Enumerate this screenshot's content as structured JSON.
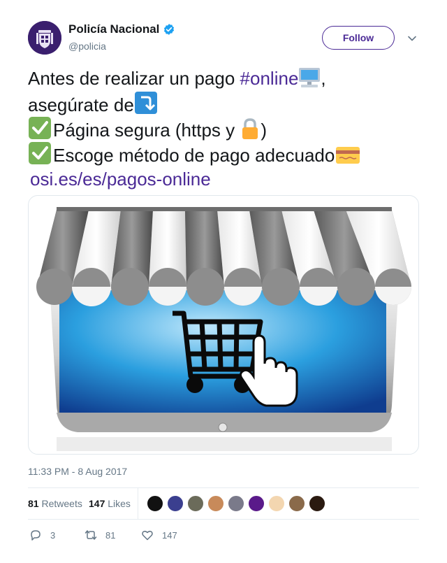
{
  "account": {
    "display_name": "Policía Nacional",
    "handle": "@policia",
    "verified": true,
    "avatar_icon": "police-crest-icon"
  },
  "follow_label": "Follow",
  "tweet": {
    "line1_text": "Antes de realizar un pago ",
    "hashtag": "#online",
    "line1_end": ",",
    "line2_text": "asegúrate de",
    "line3_text": "Página segura (https y ",
    "line3_end": ")",
    "line4_text": "Escoge método de pago adecuado",
    "link": "osi.es/es/pagos-online"
  },
  "emojis": [
    "computer-icon",
    "arrow-down-right-icon",
    "check-mark-icon",
    "lock-icon",
    "check-mark-icon",
    "credit-card-icon"
  ],
  "media": {
    "description_icon": "shopping-cart-on-monitor-illustration"
  },
  "timestamp": "11:33 PM - 8 Aug 2017",
  "stats": {
    "retweets_count": "81",
    "retweets_label": "Retweets",
    "likes_count": "147",
    "likes_label": "Likes"
  },
  "actions": {
    "replies": "3",
    "retweets": "81",
    "likes": "147"
  },
  "colors": {
    "accent": "#4b2a96",
    "verified_blue": "#1da1f2",
    "muted": "#657786"
  }
}
